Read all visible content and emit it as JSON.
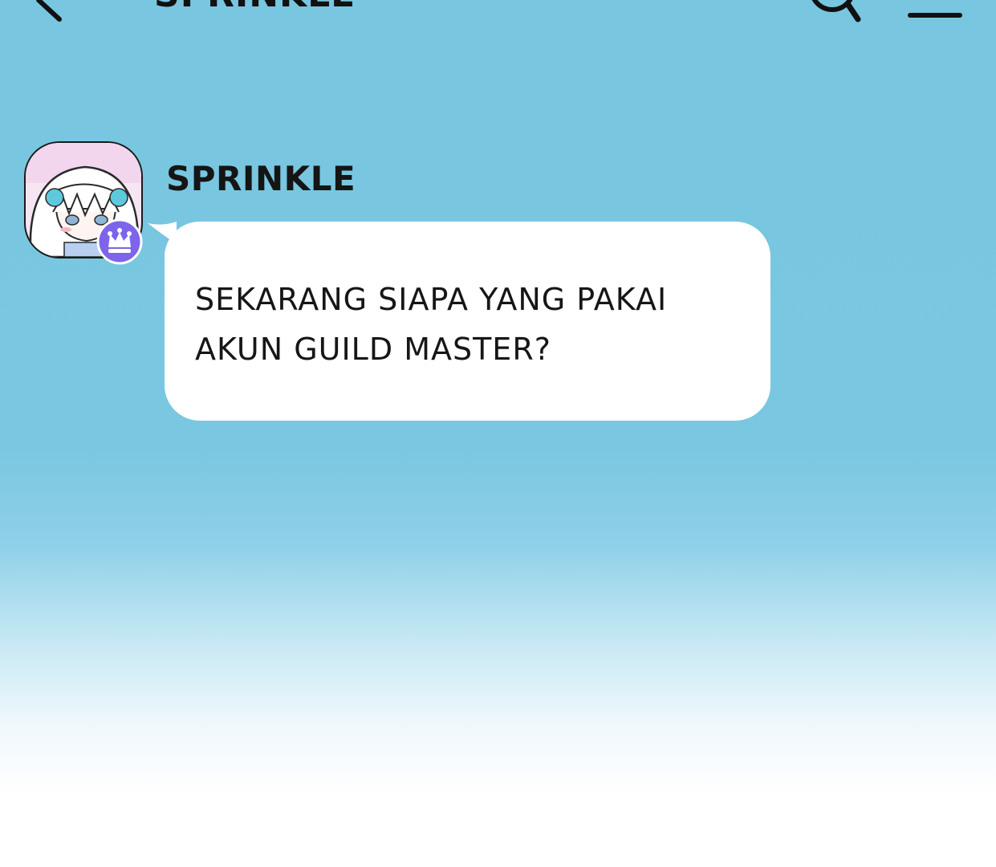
{
  "header": {
    "title": "SPRINKLE",
    "back_icon": "back-arrow-icon",
    "search_icon": "search-icon",
    "menu_icon": "menu-icon"
  },
  "message": {
    "sender": "SPRINKLE",
    "text": "SEKARANG SIAPA YANG PAKAI\nAKUN GUILD MASTER?",
    "avatar_badge_icon": "crown-icon"
  },
  "colors": {
    "background_top": "#78c6e0",
    "background_bottom": "#ffffff",
    "bubble": "#ffffff",
    "badge": "#7d64ea"
  }
}
